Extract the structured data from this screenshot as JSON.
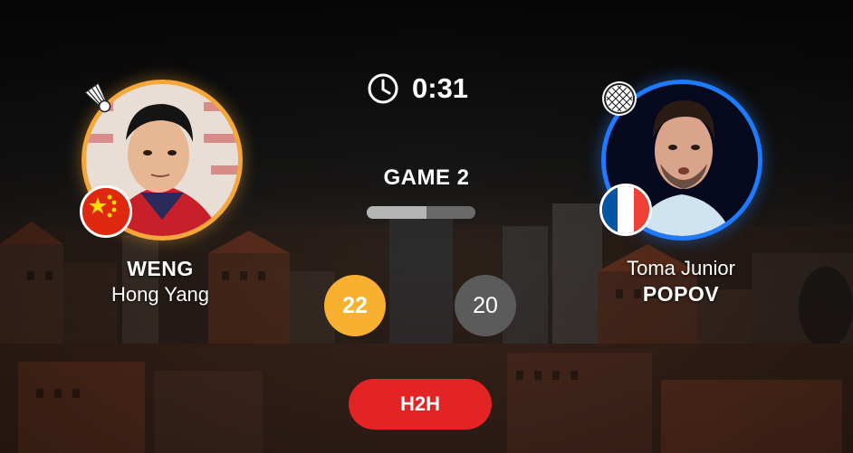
{
  "match": {
    "timer": "0:31",
    "game_label": "GAME 2",
    "game_progress": 0.55
  },
  "player_left": {
    "surname": "WENG",
    "given_name": "Hong Yang",
    "score": "22",
    "flag": "china-flag",
    "ring_color": "#f5a73a",
    "serving_icon": "shuttlecock-icon"
  },
  "player_right": {
    "given_name": "Toma Junior",
    "surname": "POPOV",
    "score": "20",
    "flag": "france-flag",
    "ring_color": "#1e7bff",
    "icon": "racket-icon"
  },
  "actions": {
    "h2h_label": "H2H"
  },
  "colors": {
    "winning_score": "#f7b030",
    "losing_score": "#5b5b5b",
    "h2h_button": "#e32424"
  }
}
